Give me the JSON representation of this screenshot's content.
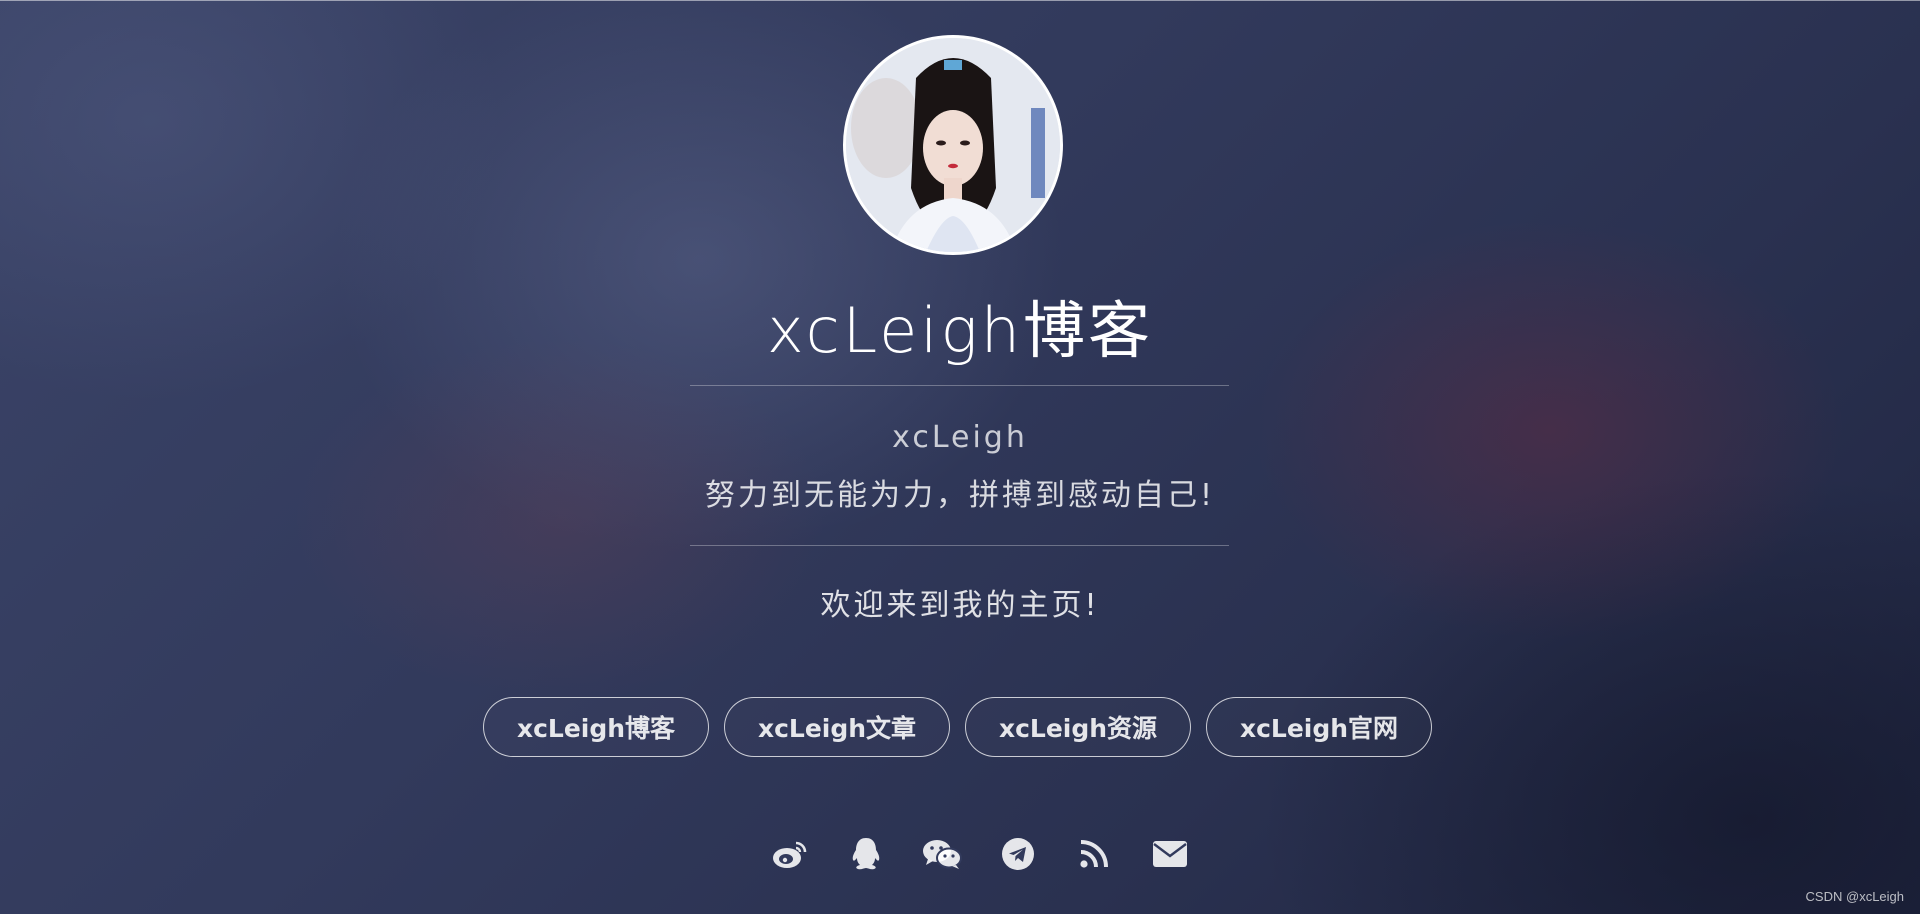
{
  "profile": {
    "site_title": "xcLeigh博客",
    "author": "xcLeigh",
    "motto": "努力到无能为力，拼搏到感动自己!",
    "welcome": "欢迎来到我的主页!"
  },
  "nav_buttons": [
    {
      "label": "xcLeigh博客"
    },
    {
      "label": "xcLeigh文章"
    },
    {
      "label": "xcLeigh资源"
    },
    {
      "label": "xcLeigh官网"
    }
  ],
  "social_icons": [
    {
      "icon": "weibo-icon"
    },
    {
      "icon": "qq-icon"
    },
    {
      "icon": "wechat-icon"
    },
    {
      "icon": "telegram-icon"
    },
    {
      "icon": "rss-icon"
    },
    {
      "icon": "email-icon"
    }
  ],
  "watermark": "CSDN @xcLeigh",
  "colors": {
    "background": "#2c3452",
    "text": "#ffffff"
  }
}
